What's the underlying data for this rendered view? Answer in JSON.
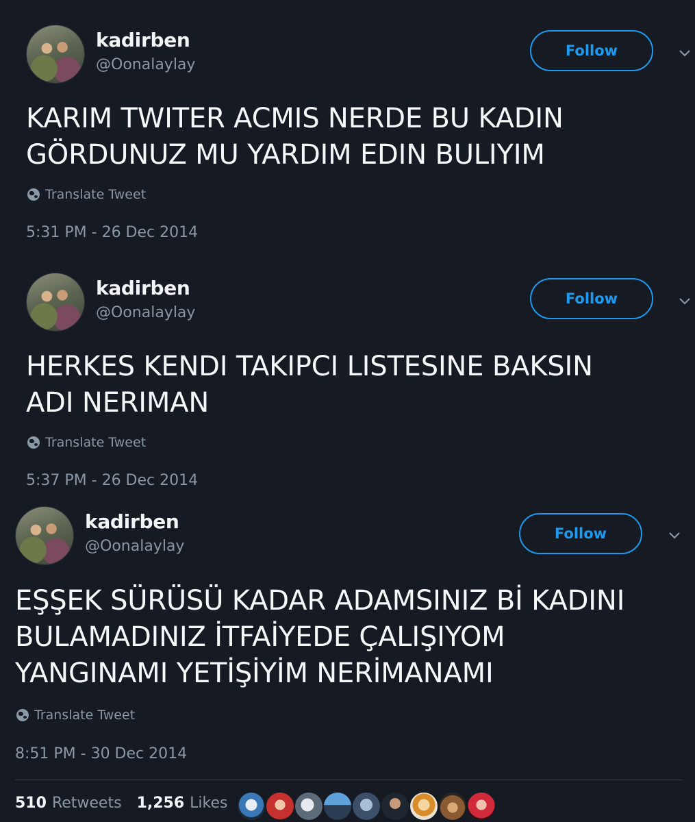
{
  "tweets": [
    {
      "name": "kadirben",
      "handle": "@Oonalaylay",
      "follow_label": "Follow",
      "text_lines": [
        "KARIM TWITER ACMIS NERDE BU KADIN",
        "GÖRDUNUZ MU YARDIM EDIN BULIYIM"
      ],
      "translate_label": "Translate Tweet",
      "timestamp": "5:31 PM - 26 Dec 2014"
    },
    {
      "name": "kadirben",
      "handle": "@Oonalaylay",
      "follow_label": "Follow",
      "text_lines": [
        "HERKES KENDI TAKIPCI LISTESINE BAKSIN",
        "ADI NERIMAN"
      ],
      "translate_label": "Translate Tweet",
      "timestamp": "5:37 PM - 26 Dec 2014"
    },
    {
      "name": "kadirben",
      "handle": "@Oonalaylay",
      "follow_label": "Follow",
      "text_lines": [
        "EŞŞEK SÜRÜSÜ KADAR ADAMSINIZ Bİ KADINI",
        "BULAMADINIZ İTFAİYEDE ÇALIŞIYOM",
        "YANGINAMI YETİŞİYİM NERİMANAMI"
      ],
      "translate_label": "Translate Tweet",
      "timestamp": "8:51 PM - 30 Dec 2014"
    }
  ],
  "stats": {
    "retweets_count": "510",
    "retweets_label": "Retweets",
    "likes_count": "1,256",
    "likes_label": "Likes"
  },
  "icons": {
    "globe": "globe-icon",
    "chevron": "chevron-down-icon"
  },
  "colors": {
    "background": "#151a23",
    "accent": "#1d9bf0",
    "secondary_text": "#8b98a5"
  }
}
